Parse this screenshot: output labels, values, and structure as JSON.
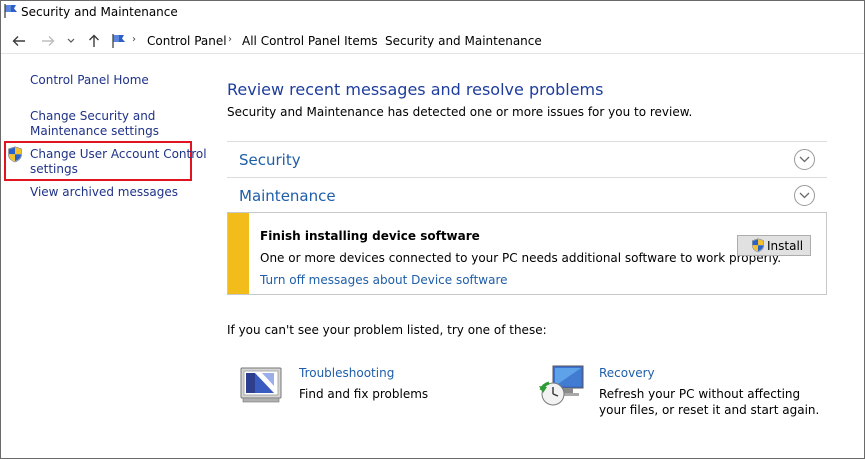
{
  "window": {
    "title": "Security and Maintenance"
  },
  "nav": {
    "back_icon": "arrow-left-icon",
    "forward_icon": "arrow-right-icon",
    "recent_icon": "chevron-down-icon",
    "up_icon": "arrow-up-icon",
    "breadcrumb": [
      "Control Panel",
      "All Control Panel Items",
      "Security and Maintenance"
    ]
  },
  "sidebar": {
    "home": "Control Panel Home",
    "items": [
      {
        "label_line1": "Change Security and",
        "label_line2": "Maintenance settings"
      },
      {
        "label_line1": "Change User Account Control",
        "label_line2": "settings",
        "highlighted": true,
        "icon": "uac-shield-icon"
      },
      {
        "label_line1": "View archived messages"
      }
    ]
  },
  "main": {
    "title": "Review recent messages and resolve problems",
    "subtitle": "Security and Maintenance has detected one or more issues for you to review.",
    "sections": [
      {
        "label": "Security",
        "expanded": false
      },
      {
        "label": "Maintenance",
        "expanded": true
      }
    ],
    "alert": {
      "title": "Finish installing device software",
      "body": "One or more devices connected to your PC needs additional software to work properly.",
      "link": "Turn off messages about Device software",
      "button": "Install",
      "color": "#f2bd1b"
    },
    "hint": "If you can't see your problem listed, try one of these:",
    "tools": [
      {
        "link": "Troubleshooting",
        "desc_line1": "Find and fix problems",
        "icon": "troubleshooting-icon"
      },
      {
        "link": "Recovery",
        "desc_line1": "Refresh your PC without affecting",
        "desc_line2": "your files, or reset it and start again.",
        "icon": "recovery-icon"
      }
    ]
  },
  "colors": {
    "link": "#1e5ea8",
    "left_link": "#1e3287",
    "highlight": "#e0141e"
  }
}
